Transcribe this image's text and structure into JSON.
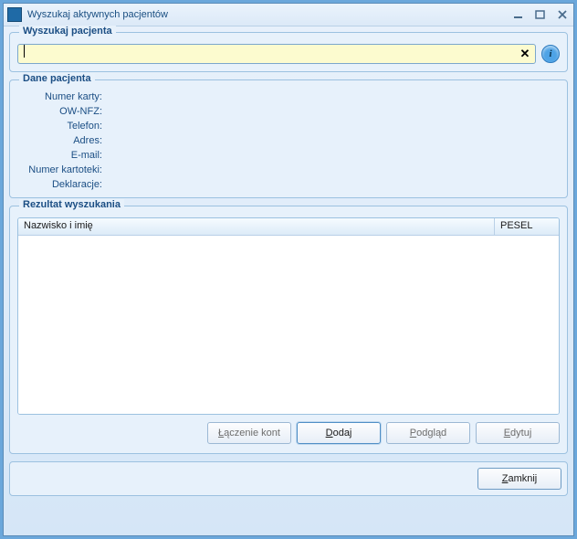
{
  "window": {
    "title": "Wyszukaj aktywnych pacjentów"
  },
  "search": {
    "group_title": "Wyszukaj pacjenta",
    "value": "",
    "clear_symbol": "✕",
    "info_symbol": "i"
  },
  "patient": {
    "group_title": "Dane pacjenta",
    "labels": {
      "card_no": "Numer karty:",
      "ow_nfz": "OW-NFZ:",
      "phone": "Telefon:",
      "address": "Adres:",
      "email": "E-mail:",
      "file_no": "Numer kartoteki:",
      "declarations": "Deklaracje:"
    },
    "values": {
      "card_no": "",
      "ow_nfz": "",
      "phone": "",
      "address": "",
      "email": "",
      "file_no": "",
      "declarations": ""
    }
  },
  "results": {
    "group_title": "Rezultat wyszukania",
    "columns": {
      "name": "Nazwisko i imię",
      "pesel": "PESEL"
    },
    "rows": []
  },
  "buttons": {
    "merge": "Łączenie kont",
    "add": "Dodaj",
    "preview": "Podgląd",
    "edit": "Edytuj",
    "close": "Zamknij"
  }
}
